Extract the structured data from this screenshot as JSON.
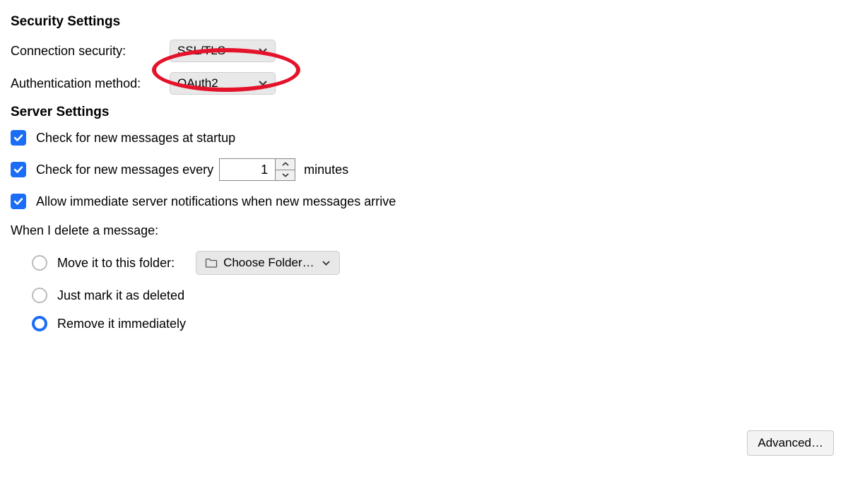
{
  "security": {
    "heading": "Security Settings",
    "connection_label": "Connection security:",
    "connection_value": "SSL/TLS",
    "auth_label": "Authentication method:",
    "auth_value": "OAuth2"
  },
  "server": {
    "heading": "Server Settings",
    "check_startup": "Check for new messages at startup",
    "check_every_prefix": "Check for new messages every",
    "check_every_value": "1",
    "check_every_suffix": "minutes",
    "allow_notifications": "Allow immediate server notifications when new messages arrive"
  },
  "delete": {
    "heading": "When I delete a message:",
    "move_to_folder": "Move it to this folder:",
    "choose_folder": "Choose Folder…",
    "mark_deleted": "Just mark it as deleted",
    "remove_immediately": "Remove it immediately"
  },
  "advanced_button": "Advanced…"
}
